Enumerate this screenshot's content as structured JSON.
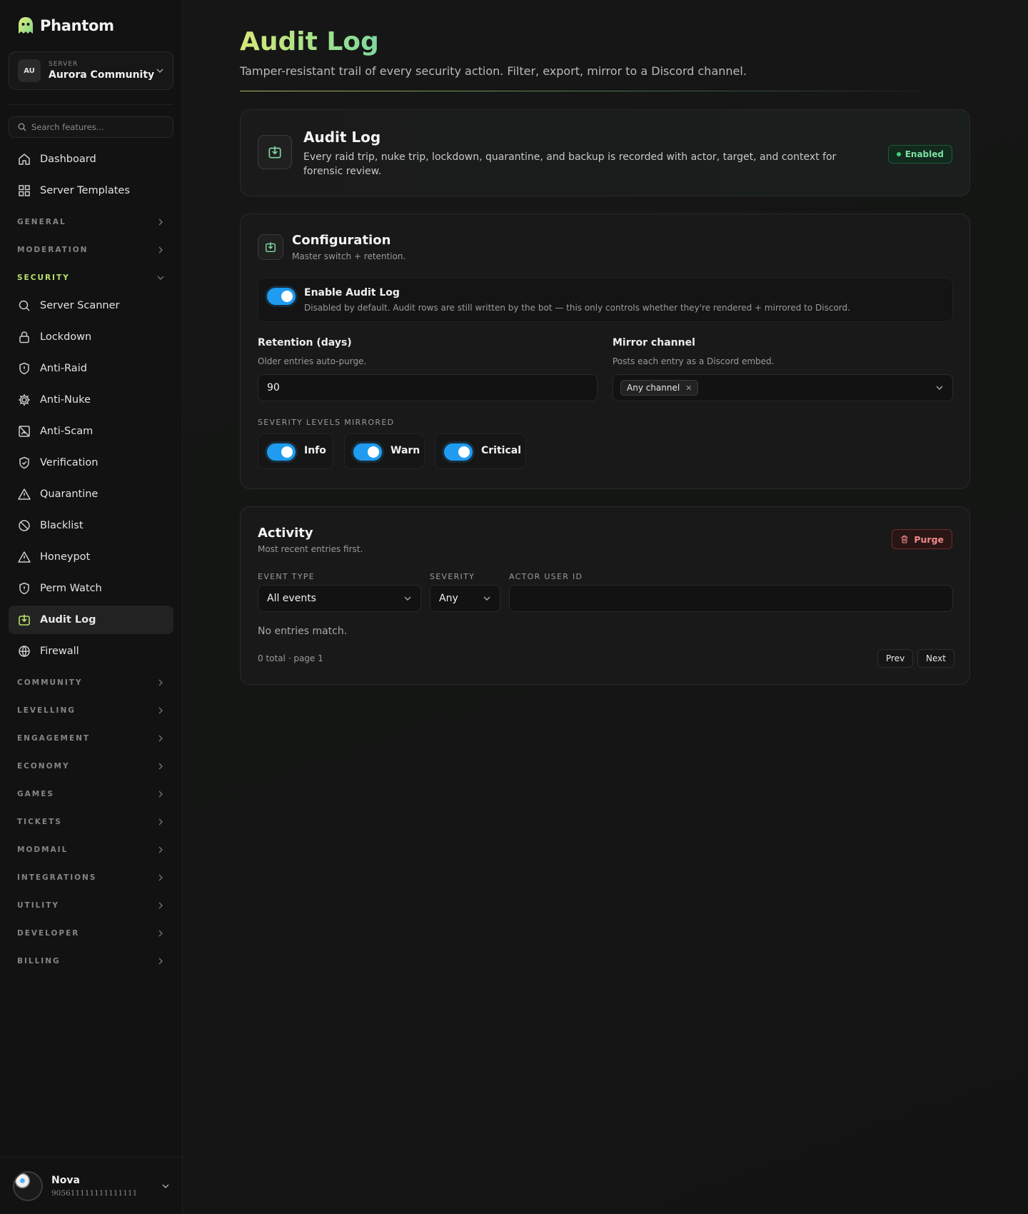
{
  "app": {
    "name": "Phantom"
  },
  "server": {
    "label": "SERVER",
    "initials": "AU",
    "name": "Aurora Community"
  },
  "search": {
    "placeholder": "Search features..."
  },
  "nav": {
    "top_items": [
      {
        "label": "Dashboard",
        "icon": "home-icon"
      },
      {
        "label": "Server Templates",
        "icon": "grid-icon"
      }
    ],
    "groups_before": [
      {
        "label": "GENERAL"
      },
      {
        "label": "MODERATION"
      }
    ],
    "open_group": {
      "label": "SECURITY"
    },
    "security_items": [
      {
        "label": "Server Scanner",
        "icon": "search-icon"
      },
      {
        "label": "Lockdown",
        "icon": "lock-icon"
      },
      {
        "label": "Anti-Raid",
        "icon": "shield-alert-icon"
      },
      {
        "label": "Anti-Nuke",
        "icon": "gear-icon"
      },
      {
        "label": "Anti-Scam",
        "icon": "image-off-icon"
      },
      {
        "label": "Verification",
        "icon": "shield-check-icon"
      },
      {
        "label": "Quarantine",
        "icon": "warning-icon"
      },
      {
        "label": "Blacklist",
        "icon": "ban-icon"
      },
      {
        "label": "Honeypot",
        "icon": "warning-icon"
      },
      {
        "label": "Perm Watch",
        "icon": "shield-alert-icon"
      },
      {
        "label": "Audit Log",
        "icon": "download-box-icon",
        "active": true
      },
      {
        "label": "Firewall",
        "icon": "globe-icon"
      }
    ],
    "groups_after": [
      {
        "label": "COMMUNITY"
      },
      {
        "label": "LEVELLING"
      },
      {
        "label": "ENGAGEMENT"
      },
      {
        "label": "ECONOMY"
      },
      {
        "label": "GAMES"
      },
      {
        "label": "TICKETS"
      },
      {
        "label": "MODMAIL"
      },
      {
        "label": "INTEGRATIONS"
      },
      {
        "label": "UTILITY"
      },
      {
        "label": "DEVELOPER"
      },
      {
        "label": "BILLING"
      }
    ]
  },
  "user": {
    "name": "Nova",
    "id": "905611111111111111"
  },
  "page": {
    "title": "Audit Log",
    "subtitle": "Tamper-resistant trail of every security action. Filter, export, mirror to a Discord channel."
  },
  "hero": {
    "title": "Audit Log",
    "description": "Every raid trip, nuke trip, lockdown, quarantine, and backup is recorded with actor, target, and context for forensic review.",
    "status": "Enabled"
  },
  "config": {
    "title": "Configuration",
    "subtitle": "Master switch + retention.",
    "enable": {
      "title": "Enable Audit Log",
      "description": "Disabled by default. Audit rows are still written by the bot — this only controls whether they're rendered + mirrored to Discord.",
      "on": true
    },
    "retention": {
      "label": "Retention (days)",
      "hint": "Older entries auto-purge.",
      "value": "90"
    },
    "mirror": {
      "label": "Mirror channel",
      "hint": "Posts each entry as a Discord embed.",
      "chip": "Any channel"
    },
    "severity": {
      "label": "SEVERITY LEVELS MIRRORED",
      "levels": [
        {
          "label": "Info",
          "on": true
        },
        {
          "label": "Warn",
          "on": true
        },
        {
          "label": "Critical",
          "on": true
        }
      ]
    }
  },
  "activity": {
    "title": "Activity",
    "subtitle": "Most recent entries first.",
    "purge_label": "Purge",
    "filters": {
      "event_type": {
        "label": "EVENT TYPE",
        "value": "All events"
      },
      "severity": {
        "label": "SEVERITY",
        "value": "Any"
      },
      "actor": {
        "label": "ACTOR USER ID",
        "value": ""
      }
    },
    "empty": "No entries match.",
    "footer": "0 total · page 1",
    "prev": "Prev",
    "next": "Next"
  },
  "colors": {
    "accent_green": "#b9e06a",
    "toggle_blue": "#1f9cf0",
    "enabled_green": "#7ee0a4",
    "danger_red": "#f08a8a"
  }
}
